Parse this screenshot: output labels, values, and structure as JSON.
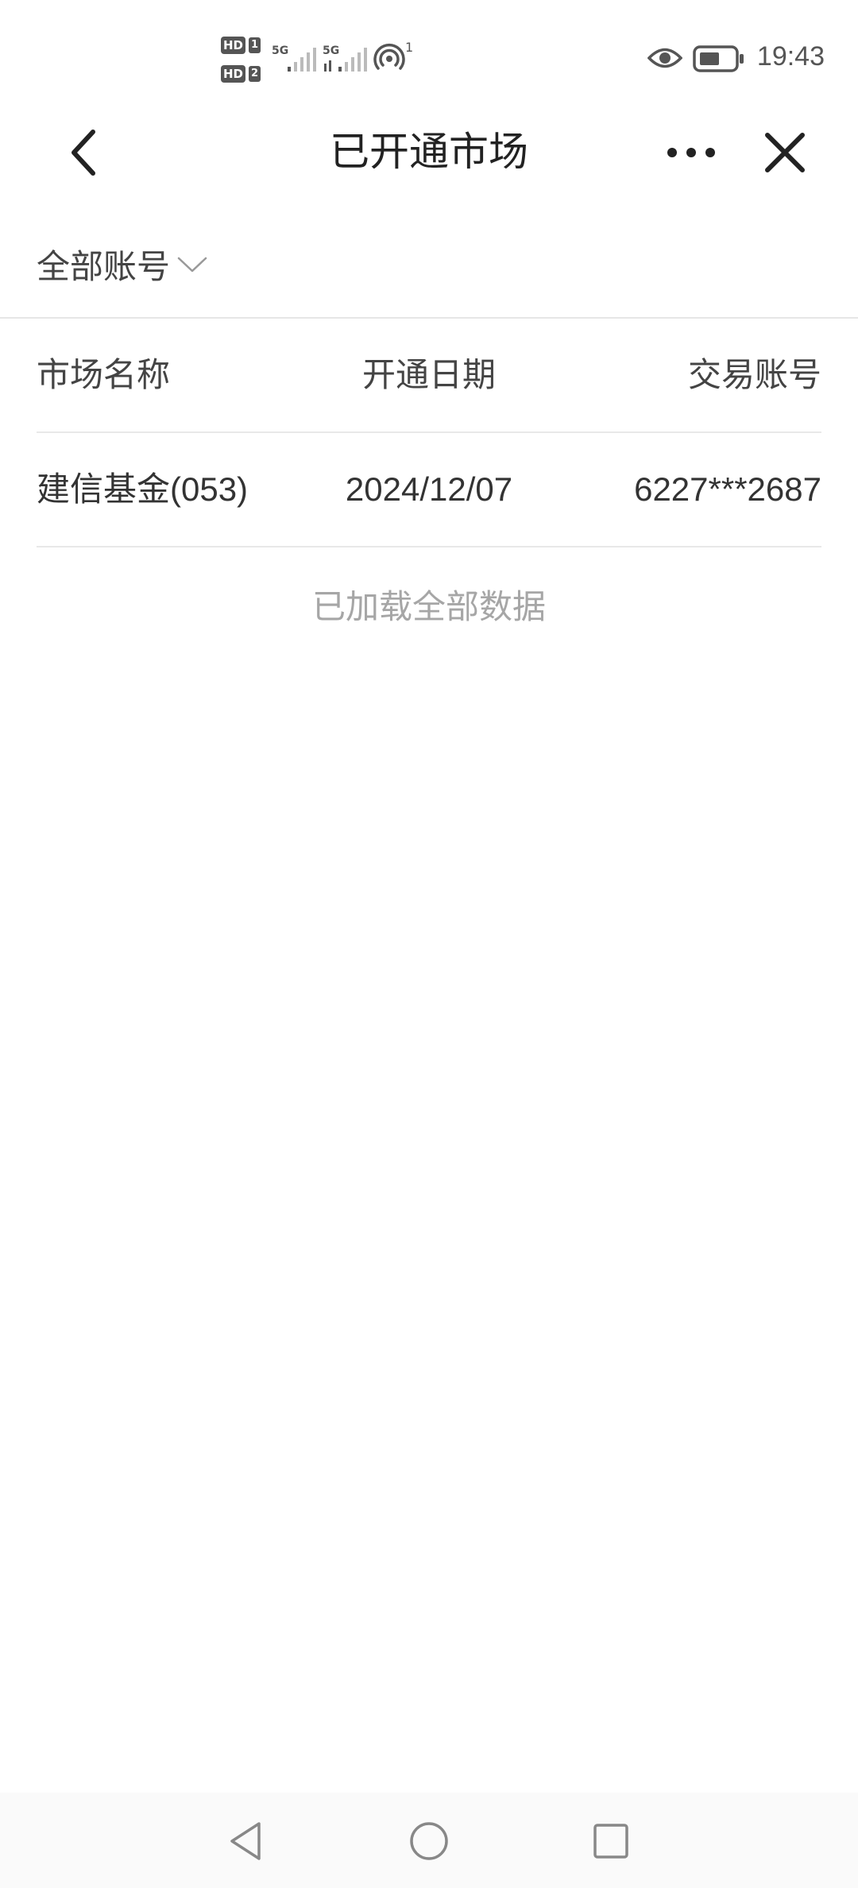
{
  "status_bar": {
    "sim1_hd": "HD",
    "sim1_num": "1",
    "sim2_hd": "HD",
    "sim2_num": "2",
    "net1": "5G",
    "net2": "5G",
    "hotspot_count": "1",
    "time": "19:43",
    "icons": [
      "signal-icon",
      "hotspot-icon",
      "eye-icon",
      "battery-icon"
    ]
  },
  "nav": {
    "back_icon": "chevron-left-icon",
    "title": "已开通市场",
    "more_icon": "more-dots-icon",
    "close_icon": "close-icon"
  },
  "filter": {
    "label": "全部账号",
    "icon": "chevron-down-icon"
  },
  "table": {
    "headers": {
      "name": "市场名称",
      "date": "开通日期",
      "account": "交易账号"
    },
    "rows": [
      {
        "name": "建信基金(053)",
        "date": "2024/12/07",
        "account": "6227***2687"
      }
    ]
  },
  "footer": {
    "loaded_all": "已加载全部数据"
  },
  "system_nav": {
    "icons": [
      "back-triangle-icon",
      "home-circle-icon",
      "recent-square-icon"
    ]
  },
  "colors": {
    "text_primary": "#333333",
    "text_muted": "#a6a6a6",
    "divider": "#e8e8e8",
    "background": "#ffffff"
  }
}
